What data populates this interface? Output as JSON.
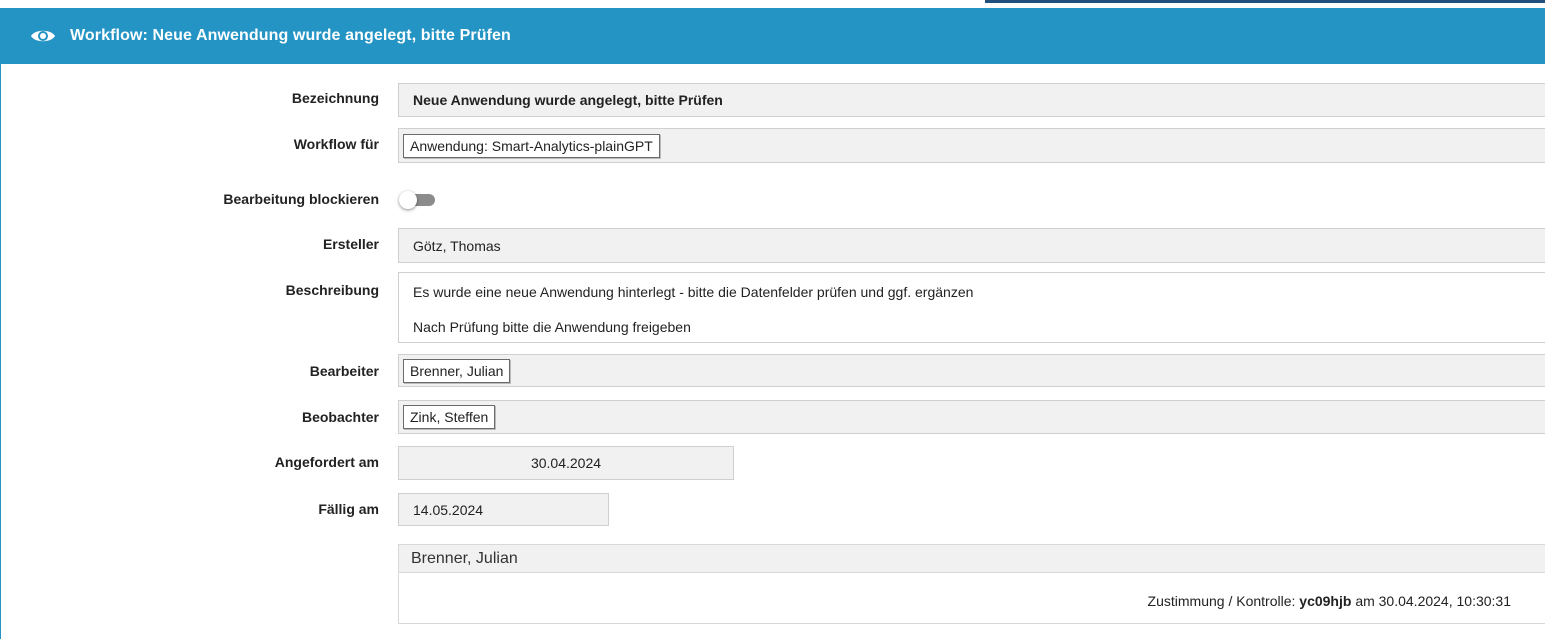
{
  "header": {
    "title": "Workflow: Neue Anwendung wurde angelegt, bitte Prüfen",
    "icon": "eye-icon",
    "color": "#2494c5"
  },
  "form": {
    "bezeichnung": {
      "label": "Bezeichnung",
      "value": "Neue Anwendung wurde angelegt, bitte Prüfen"
    },
    "workflow_fuer": {
      "label": "Workflow für",
      "value": "Anwendung: Smart-Analytics-plainGPT"
    },
    "bearbeitung_blockieren": {
      "label": "Bearbeitung blockieren",
      "state": "off"
    },
    "ersteller": {
      "label": "Ersteller",
      "value": "Götz, Thomas"
    },
    "beschreibung": {
      "label": "Beschreibung",
      "line1": "Es wurde eine neue Anwendung hinterlegt - bitte die Datenfelder prüfen und ggf. ergänzen",
      "line2": "Nach Prüfung bitte die Anwendung freigeben"
    },
    "bearbeiter": {
      "label": "Bearbeiter",
      "value": "Brenner, Julian"
    },
    "beobachter": {
      "label": "Beobachter",
      "value": "Zink, Steffen"
    },
    "angefordert_am": {
      "label": "Angefordert am",
      "value": "30.04.2024"
    },
    "faellig_am": {
      "label": "Fällig am",
      "value": "14.05.2024"
    }
  },
  "approval": {
    "name": "Brenner, Julian",
    "prefix": "Zustimmung / Kontrolle:",
    "user": "yc09hjb",
    "suffix": "am 30.04.2024, 10:30:31"
  }
}
